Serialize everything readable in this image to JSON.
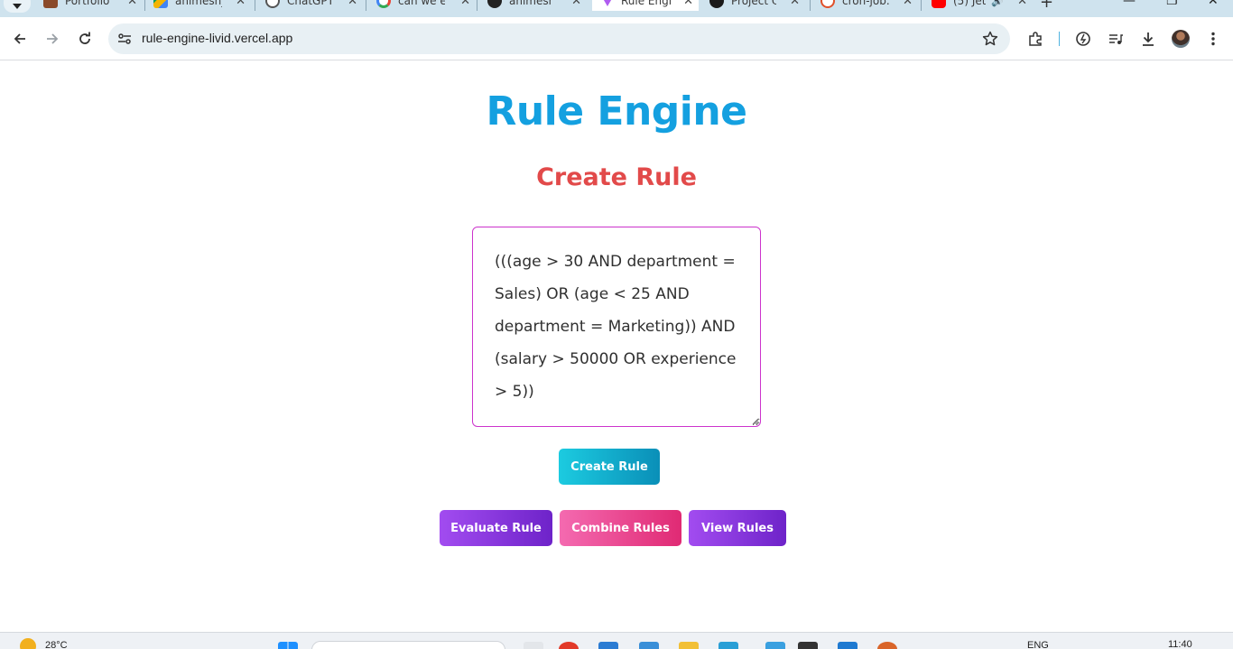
{
  "browser": {
    "tabs": [
      {
        "title": "Portfolio",
        "color": "#8a4a2a"
      },
      {
        "title": "animesh_",
        "color": "#4a8af0"
      },
      {
        "title": "ChatGPT",
        "color": "#555555"
      },
      {
        "title": "can we ed",
        "color": "#4285f4"
      },
      {
        "title": "animesh",
        "color": "#222222"
      },
      {
        "title": "Rule Engin",
        "color": "#b05cf0",
        "active": true
      },
      {
        "title": "Project O",
        "color": "#1a1a1a"
      },
      {
        "title": "cron-job.o",
        "color": "#e0502a"
      },
      {
        "title": "(5) Jet",
        "color": "#ff0000"
      }
    ],
    "url": "rule-engine-livid.vercel.app"
  },
  "page": {
    "title": "Rule Engine",
    "subtitle": "Create Rule",
    "rule_text": "(((age > 30 AND department = Sales) OR (age < 25 AND department = Marketing)) AND (salary > 50000 OR experience > 5))",
    "buttons": {
      "create": "Create Rule",
      "evaluate": "Evaluate Rule",
      "combine": "Combine Rules",
      "view": "View Rules"
    }
  },
  "taskbar": {
    "temperature": "28°C",
    "language": "ENG",
    "time": "11:40"
  }
}
